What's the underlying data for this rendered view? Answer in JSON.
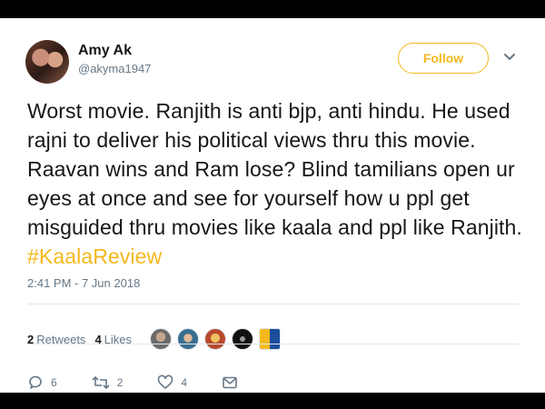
{
  "user": {
    "name": "Amy Ak",
    "handle": "@akyma1947"
  },
  "follow": {
    "label": "Follow"
  },
  "tweet": {
    "text": "Worst movie. Ranjith is anti bjp, anti hindu. He used rajni to deliver his political views thru this movie. Raavan wins and Ram lose? Blind tamilians open ur eyes at once and see for yourself how u ppl get misguided thru movies like kaala and ppl like Ranjith.",
    "hashtag": "#KaalaReview",
    "timestamp": "2:41 PM - 7 Jun 2018"
  },
  "stats": {
    "retweets_count": "2",
    "retweets_label": "Retweets",
    "likes_count": "4",
    "likes_label": "Likes"
  },
  "actions": {
    "reply_count": "6",
    "retweet_count": "2",
    "like_count": "4"
  },
  "colors": {
    "accent": "#f5b81c",
    "secondary_text": "#657786"
  }
}
